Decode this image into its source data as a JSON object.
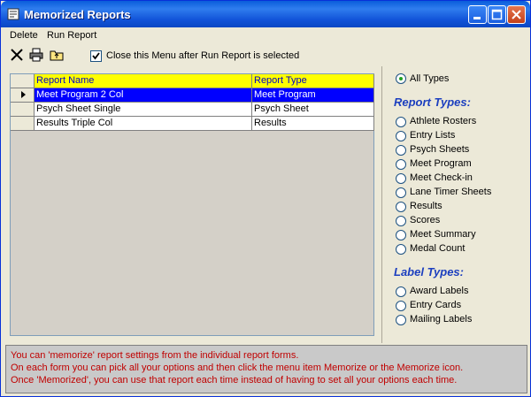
{
  "window": {
    "title": "Memorized Reports"
  },
  "menu": {
    "delete": "Delete",
    "run_report": "Run Report"
  },
  "toolbar": {
    "close_menu_label": "Close this Menu after Run Report is selected",
    "close_menu_checked": true
  },
  "grid": {
    "headers": {
      "name": "Report Name",
      "type": "Report Type"
    },
    "rows": [
      {
        "name": "Meet Program 2 Col",
        "type": "Meet Program",
        "selected": true
      },
      {
        "name": "Psych Sheet Single",
        "type": "Psych Sheet",
        "selected": false
      },
      {
        "name": "Results Triple Col",
        "type": "Results",
        "selected": false
      }
    ]
  },
  "filters": {
    "all_types": "All Types",
    "report_types_title": "Report Types:",
    "report_types": [
      "Athlete Rosters",
      "Entry Lists",
      "Psych Sheets",
      "Meet Program",
      "Meet Check-in",
      "Lane Timer Sheets",
      "Results",
      "Scores",
      "Meet Summary",
      "Medal Count"
    ],
    "label_types_title": "Label Types:",
    "label_types": [
      "Award Labels",
      "Entry Cards",
      "Mailing Labels"
    ]
  },
  "info": {
    "lines": [
      "You can 'memorize' report settings from the individual report forms.",
      "On each form you can pick all your options and then click the menu item Memorize or the Memorize icon.",
      "Once 'Memorized', you can use that report each time instead of having to set all your options each time."
    ]
  }
}
